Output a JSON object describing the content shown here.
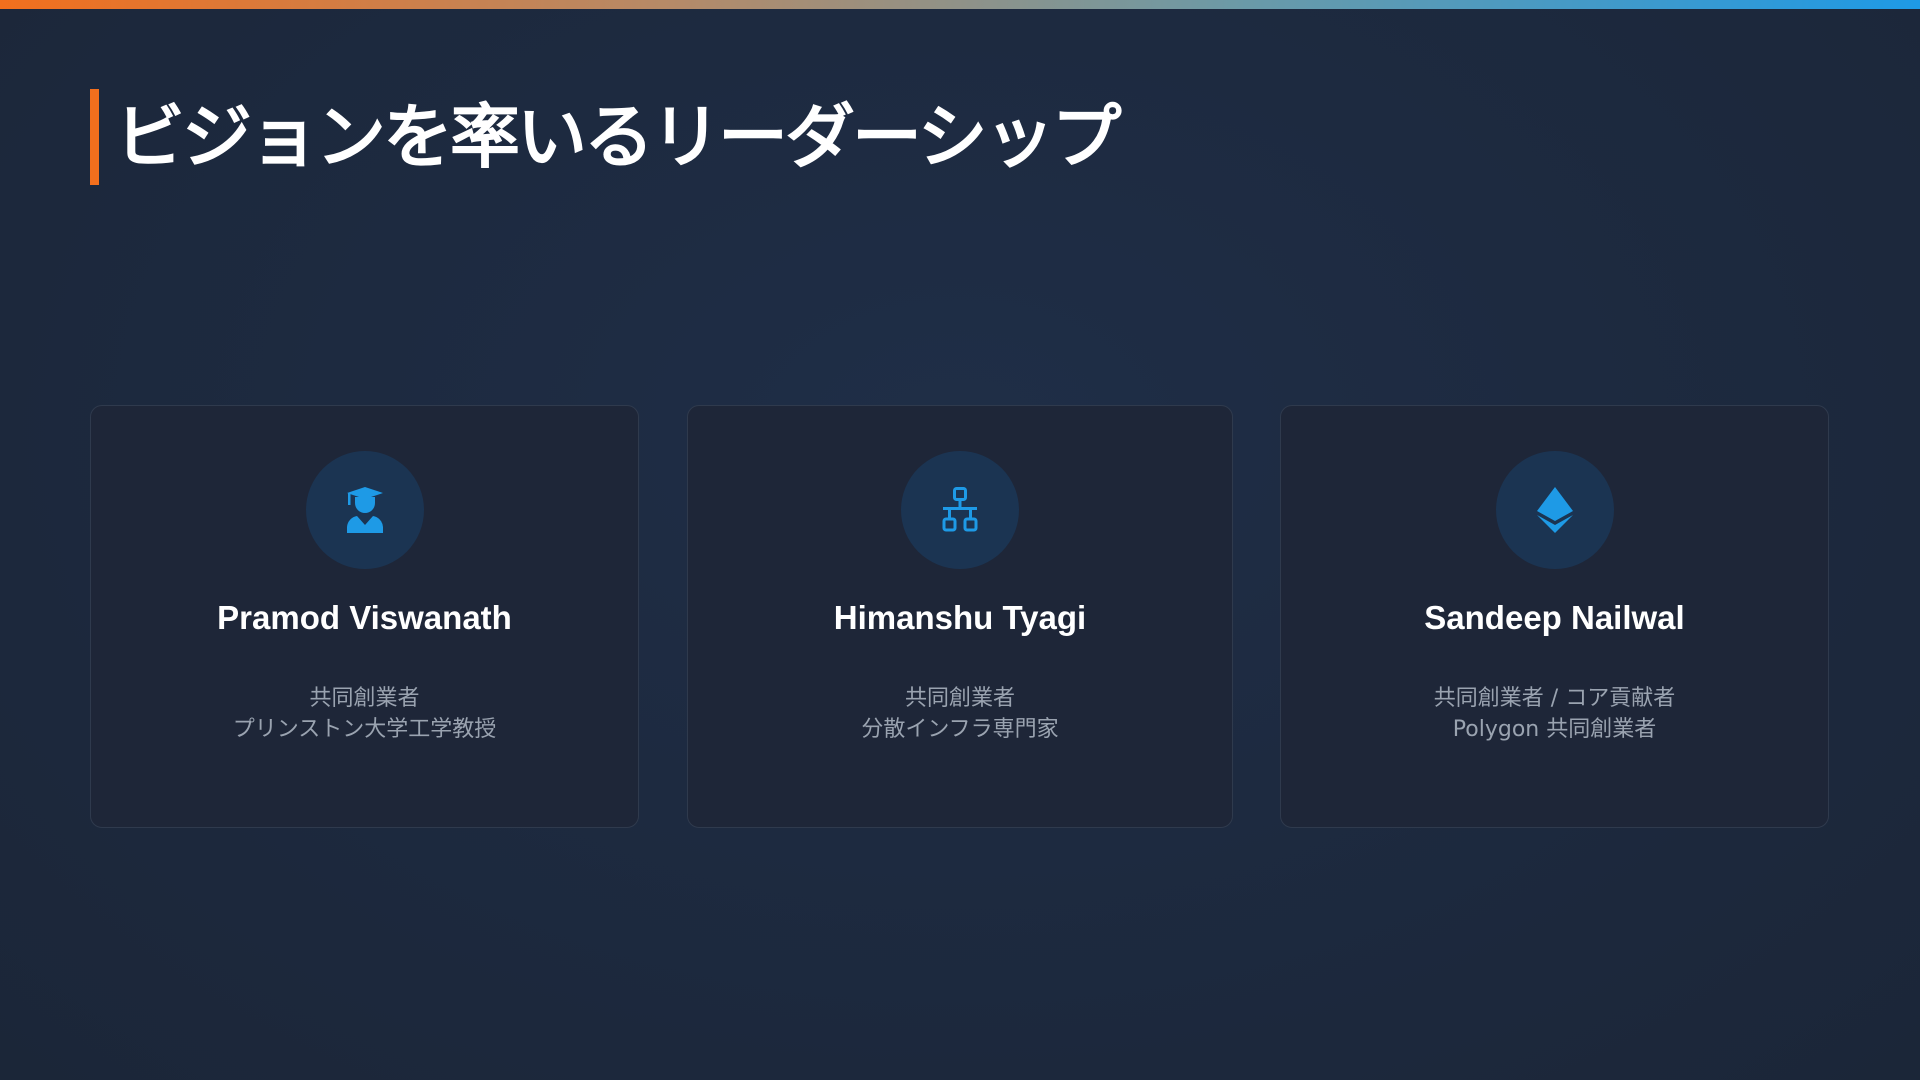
{
  "slide": {
    "title": "ビジョンを率いるリーダーシップ",
    "accent_color": "#f26f1d",
    "icon_color": "#1e9ae6"
  },
  "leaders": [
    {
      "name": "Pramod Viswanath",
      "icon": "graduate-icon",
      "role_lines": [
        "共同創業者",
        "プリンストン大学工学教授"
      ]
    },
    {
      "name": "Himanshu Tyagi",
      "icon": "network-icon",
      "role_lines": [
        "共同創業者",
        "分散インフラ専門家"
      ]
    },
    {
      "name": "Sandeep Nailwal",
      "icon": "ethereum-icon",
      "role_lines": [
        "共同創業者 / コア貢献者",
        "Polygon 共同創業者"
      ]
    }
  ]
}
